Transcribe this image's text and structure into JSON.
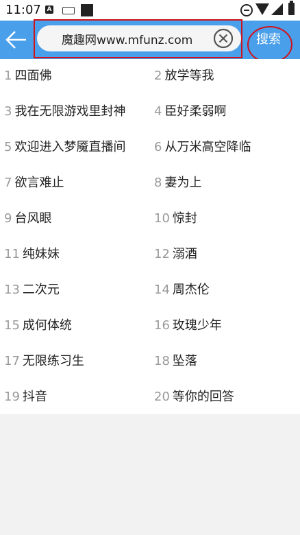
{
  "status_bar": {
    "time": "11:07",
    "notif_a": "A"
  },
  "header": {
    "back_icon": "arrow-left-icon",
    "search_value": "魔趣网www.mfunz.com",
    "clear_icon": "clear-circle-x-icon",
    "search_button_label": "搜索",
    "accent_color": "#4a9fea"
  },
  "hot_list": [
    {
      "num": "1",
      "title": "四面佛"
    },
    {
      "num": "2",
      "title": "放学等我"
    },
    {
      "num": "3",
      "title": "我在无限游戏里封神"
    },
    {
      "num": "4",
      "title": "臣好柔弱啊"
    },
    {
      "num": "5",
      "title": "欢迎进入梦魇直播间"
    },
    {
      "num": "6",
      "title": "从万米高空降临"
    },
    {
      "num": "7",
      "title": "欲言难止"
    },
    {
      "num": "8",
      "title": "妻为上"
    },
    {
      "num": "9",
      "title": "台风眼"
    },
    {
      "num": "10",
      "title": "惊封"
    },
    {
      "num": "11",
      "title": "纯妹妹"
    },
    {
      "num": "12",
      "title": "溺酒"
    },
    {
      "num": "13",
      "title": "二次元"
    },
    {
      "num": "14",
      "title": "周杰伦"
    },
    {
      "num": "15",
      "title": "成何体统"
    },
    {
      "num": "16",
      "title": "玫瑰少年"
    },
    {
      "num": "17",
      "title": "无限练习生"
    },
    {
      "num": "18",
      "title": "坠落"
    },
    {
      "num": "19",
      "title": "抖音"
    },
    {
      "num": "20",
      "title": "等你的回答"
    }
  ]
}
